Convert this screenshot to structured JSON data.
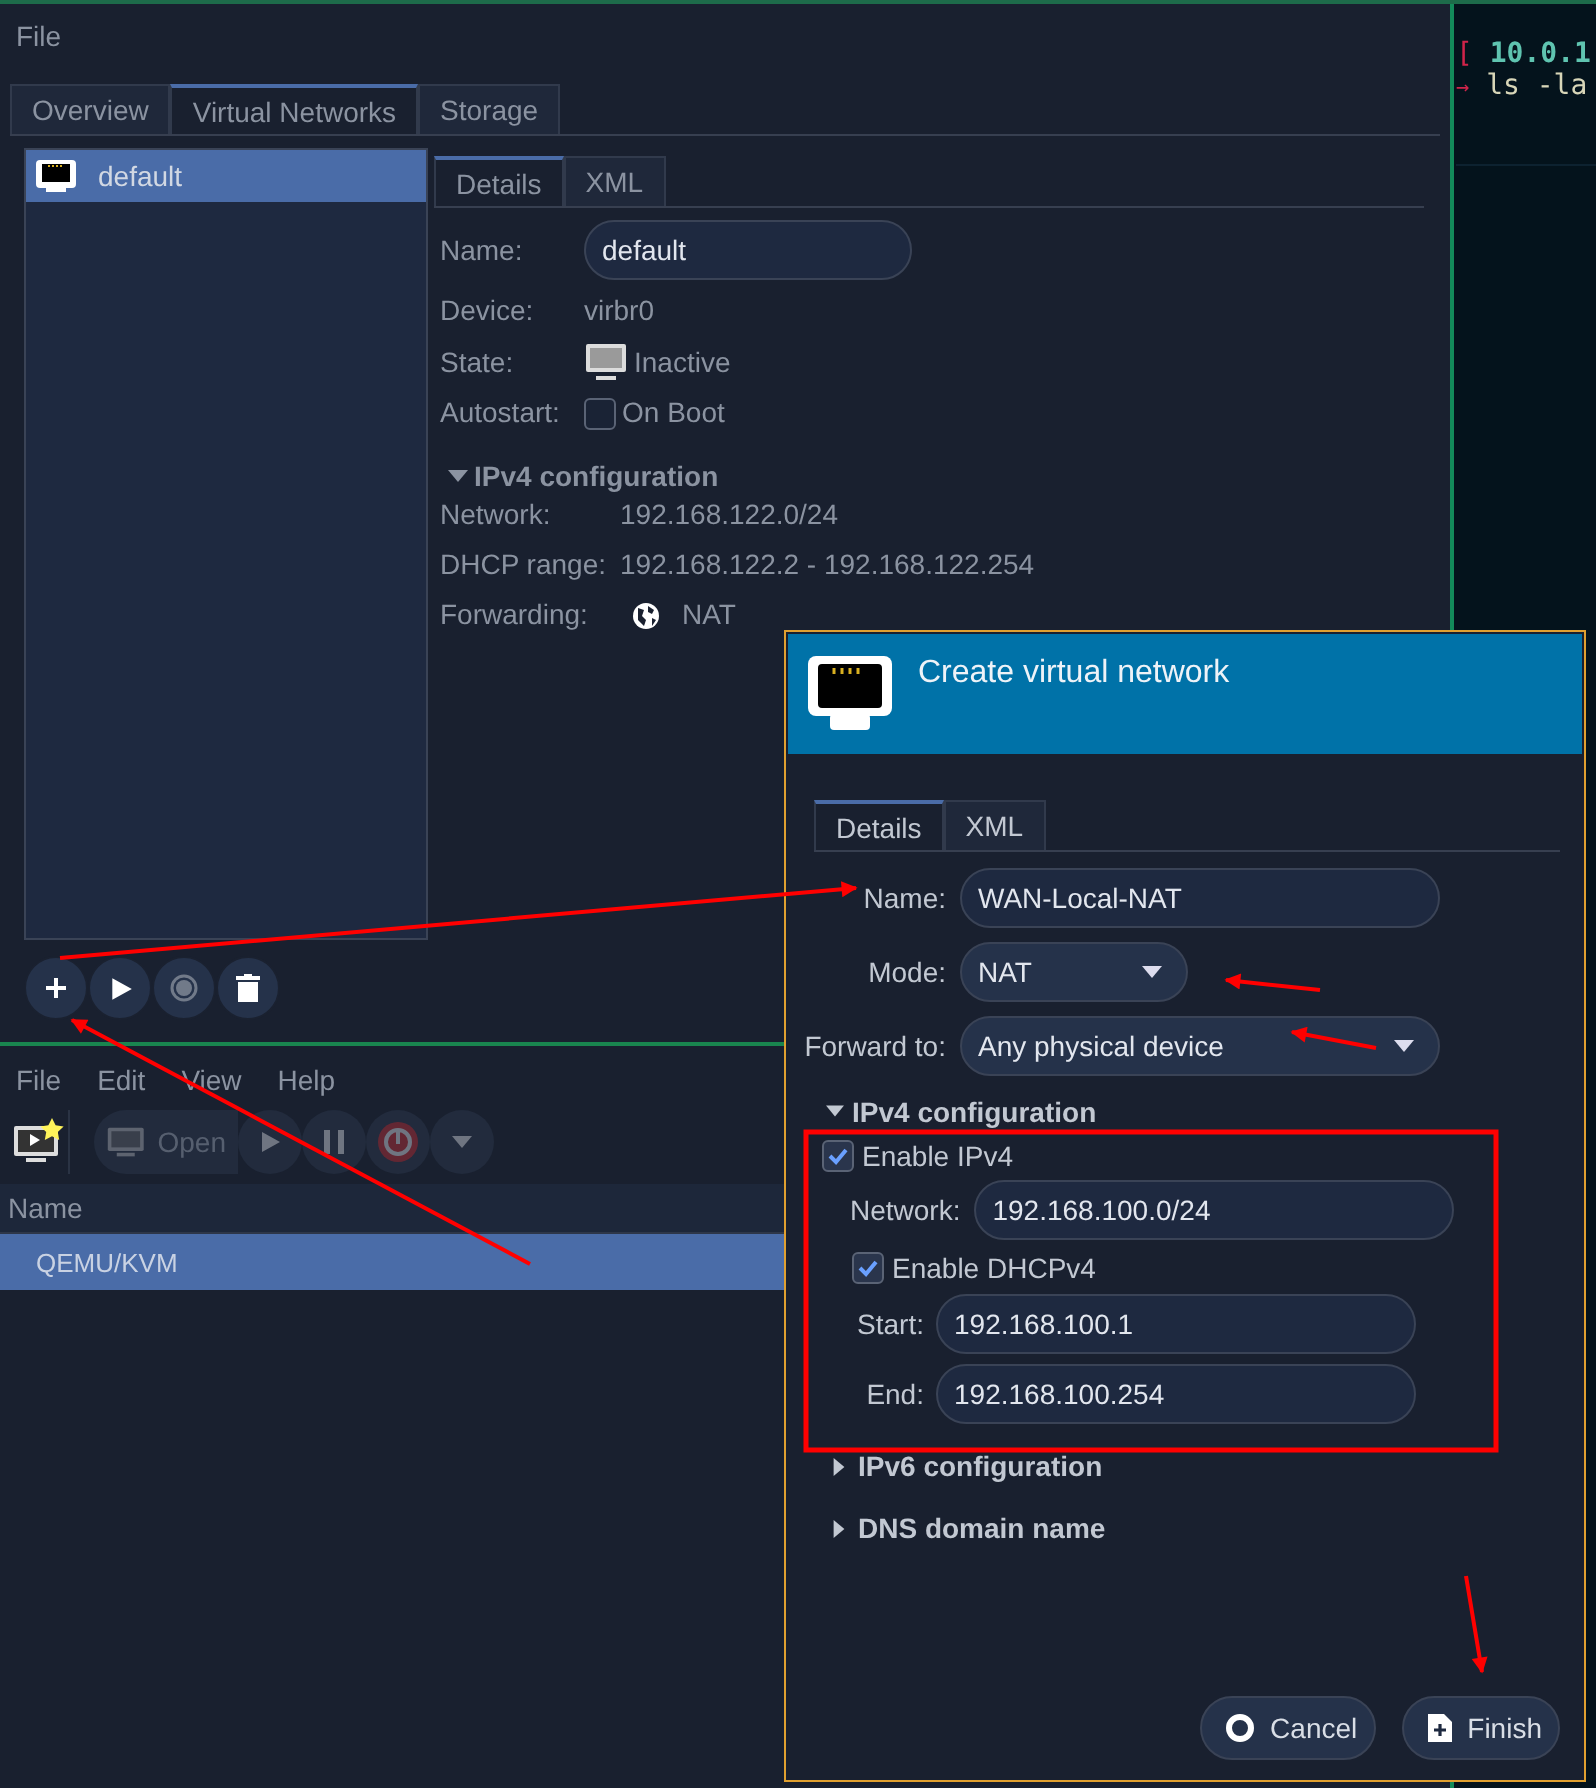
{
  "details_window": {
    "menu": [
      {
        "label": "File"
      }
    ],
    "tabs": [
      {
        "label": "Overview",
        "selected": false
      },
      {
        "label": "Virtual Networks",
        "selected": true
      },
      {
        "label": "Storage",
        "selected": false
      }
    ],
    "networks": [
      {
        "name": "default",
        "selected": true
      }
    ],
    "detail_tabs": [
      {
        "label": "Details",
        "selected": true
      },
      {
        "label": "XML",
        "selected": false
      }
    ],
    "details": {
      "name_label": "Name:",
      "name": "default",
      "device_label": "Device:",
      "device": "virbr0",
      "state_label": "State:",
      "state": "Inactive",
      "autostart_label": "Autostart:",
      "autostart_option": "On Boot",
      "autostart_checked": false,
      "ipv4": {
        "title": "IPv4 configuration",
        "expanded": true,
        "rows": [
          {
            "label": "Network:",
            "value": "192.168.122.0/24"
          },
          {
            "label": "DHCP range:",
            "value": "192.168.122.2 - 192.168.122.254"
          }
        ],
        "forwarding_label": "Forwarding:",
        "forwarding": "NAT"
      }
    },
    "buttons": [
      {
        "kind": "add",
        "disabled": false
      },
      {
        "kind": "start",
        "disabled": false
      },
      {
        "kind": "stop",
        "disabled": true
      },
      {
        "kind": "delete",
        "disabled": false
      }
    ]
  },
  "manager_window": {
    "menu": [
      {
        "label": "File"
      },
      {
        "label": "Edit"
      },
      {
        "label": "View"
      },
      {
        "label": "Help"
      }
    ],
    "toolbar": [
      {
        "kind": "new",
        "disabled": false
      },
      {
        "kind": "open",
        "label": "Open",
        "disabled": true
      },
      {
        "kind": "run",
        "disabled": true
      },
      {
        "kind": "pause",
        "disabled": true
      },
      {
        "kind": "shutdown",
        "disabled": true
      },
      {
        "kind": "dropdown",
        "disabled": true
      }
    ],
    "columns": [
      "Name"
    ],
    "rows": [
      {
        "name": "QEMU/KVM",
        "selected": true
      }
    ]
  },
  "terminal": {
    "lines": [
      {
        "kind": "prompt",
        "mark": "[",
        "text": "10.0.1"
      },
      {
        "kind": "command",
        "mark": "→",
        "text": "ls -la"
      }
    ]
  },
  "dialog": {
    "title": "Create virtual network",
    "tabs": [
      {
        "label": "Details",
        "selected": true
      },
      {
        "label": "XML",
        "selected": false
      }
    ],
    "fields": [
      {
        "kind": "entry",
        "label": "Name:",
        "value": "WAN-Local-NAT"
      },
      {
        "kind": "combo",
        "label": "Mode:",
        "value": "NAT"
      },
      {
        "kind": "combo",
        "label": "Forward to:",
        "value": "Any physical device"
      }
    ],
    "ipv4": {
      "title": "IPv4 configuration",
      "expanded": true,
      "enable_label": "Enable IPv4",
      "enabled": true,
      "network_label": "Network:",
      "network": "192.168.100.0/24",
      "dhcp_label": "Enable DHCPv4",
      "dhcp_enabled": true,
      "start_label": "Start:",
      "start": "192.168.100.1",
      "end_label": "End:",
      "end": "192.168.100.254"
    },
    "sections": [
      {
        "title": "IPv6 configuration",
        "expanded": false
      },
      {
        "title": "DNS domain name",
        "expanded": false
      }
    ],
    "buttons": [
      {
        "kind": "cancel",
        "label": "Cancel"
      },
      {
        "kind": "finish",
        "label": "Finish"
      }
    ]
  }
}
